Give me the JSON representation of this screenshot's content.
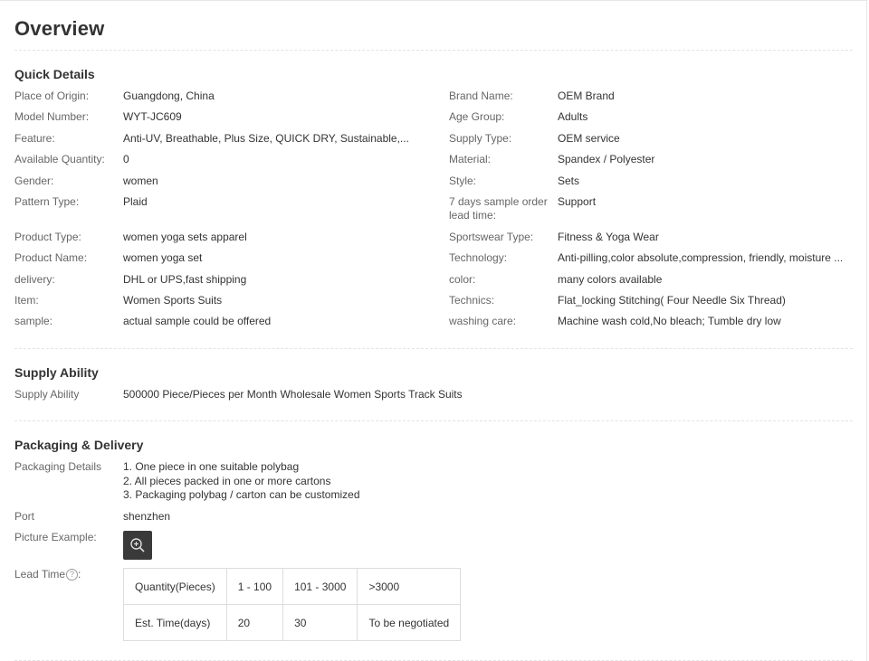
{
  "title": "Overview",
  "quick_details": {
    "heading": "Quick Details",
    "left": [
      {
        "label": "Place of Origin:",
        "value": "Guangdong, China"
      },
      {
        "label": "Model Number:",
        "value": "WYT-JC609"
      },
      {
        "label": "Feature:",
        "value": "Anti-UV, Breathable, Plus Size, QUICK DRY, Sustainable,..."
      },
      {
        "label": "Available Quantity:",
        "value": "0"
      },
      {
        "label": "Gender:",
        "value": "women"
      },
      {
        "label": "Pattern Type:",
        "value": "Plaid"
      },
      {
        "label": "Product Type:",
        "value": "women yoga sets apparel"
      },
      {
        "label": "Product Name:",
        "value": "women yoga set"
      },
      {
        "label": "delivery:",
        "value": "DHL or UPS,fast shipping"
      },
      {
        "label": "Item:",
        "value": "Women Sports Suits"
      },
      {
        "label": "sample:",
        "value": "actual sample could be offered"
      }
    ],
    "right": [
      {
        "label": "Brand Name:",
        "value": "OEM Brand"
      },
      {
        "label": "Age Group:",
        "value": "Adults"
      },
      {
        "label": "Supply Type:",
        "value": "OEM service"
      },
      {
        "label": "Material:",
        "value": "Spandex / Polyester"
      },
      {
        "label": "Style:",
        "value": "Sets"
      },
      {
        "label": "7 days sample order lead time:",
        "value": "Support"
      },
      {
        "label": "Sportswear Type:",
        "value": "Fitness & Yoga Wear"
      },
      {
        "label": "Technology:",
        "value": "Anti-pilling,color absolute,compression, friendly, moisture ..."
      },
      {
        "label": "color:",
        "value": "many colors available"
      },
      {
        "label": "Technics:",
        "value": "Flat_locking Stitching( Four Needle Six Thread)"
      },
      {
        "label": "washing care:",
        "value": "Machine wash cold,No bleach; Tumble dry low"
      }
    ]
  },
  "supply_ability": {
    "heading": "Supply Ability",
    "label": "Supply Ability",
    "value": "500000 Piece/Pieces per Month Wholesale Women Sports Track Suits"
  },
  "packaging": {
    "heading": "Packaging & Delivery",
    "details_label": "Packaging Details",
    "details_lines": [
      "1. One piece in one suitable polybag",
      "2. All pieces packed in one or more cartons",
      "3. Packaging polybag / carton can be customized"
    ],
    "port_label": "Port",
    "port_value": "shenzhen",
    "picture_label": "Picture Example:",
    "lead_time_label": "Lead Time",
    "lead_time_help": "?",
    "lead_time_colon": ":",
    "lead_table": {
      "header": [
        "Quantity(Pieces)",
        "1 - 100",
        "101 - 3000",
        ">3000"
      ],
      "row": [
        "Est. Time(days)",
        "20",
        "30",
        "To be negotiated"
      ]
    }
  },
  "icons": {
    "zoom": "zoom-in-icon",
    "help": "question-circle-icon"
  }
}
